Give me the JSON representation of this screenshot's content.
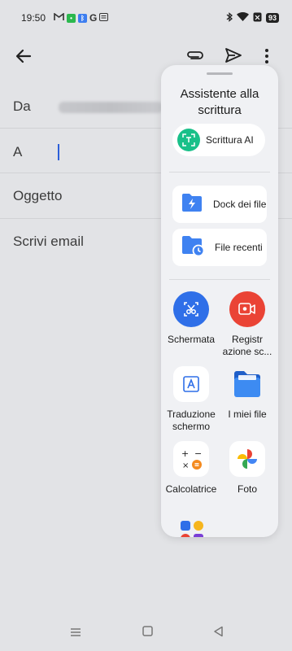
{
  "status": {
    "time": "19:50",
    "battery": "93"
  },
  "compose": {
    "from_label": "Da",
    "to_label": "A",
    "subject_placeholder": "Oggetto",
    "body_placeholder": "Scrivi email"
  },
  "panel": {
    "title": "Assistente alla scrittura",
    "ai_button": "Scrittura AI",
    "cards": [
      {
        "label": "Dock dei file",
        "icon": "folder-bolt-icon"
      },
      {
        "label": "File recenti",
        "icon": "folder-clock-icon"
      }
    ],
    "apps": [
      {
        "label": "Schermata",
        "icon": "scissors-icon"
      },
      {
        "label": "Registr azione sc...",
        "icon": "screen-record-icon"
      },
      {
        "label": "Traduzione schermo",
        "icon": "translate-icon"
      },
      {
        "label": "I miei file",
        "icon": "files-folder-icon"
      },
      {
        "label": "Calcolatrice",
        "icon": "calculator-icon"
      },
      {
        "label": "Foto",
        "icon": "photos-icon"
      }
    ]
  },
  "colors": {
    "accent_blue": "#2f6fe8",
    "ai_green": "#19c089",
    "record_red": "#ea4335"
  }
}
